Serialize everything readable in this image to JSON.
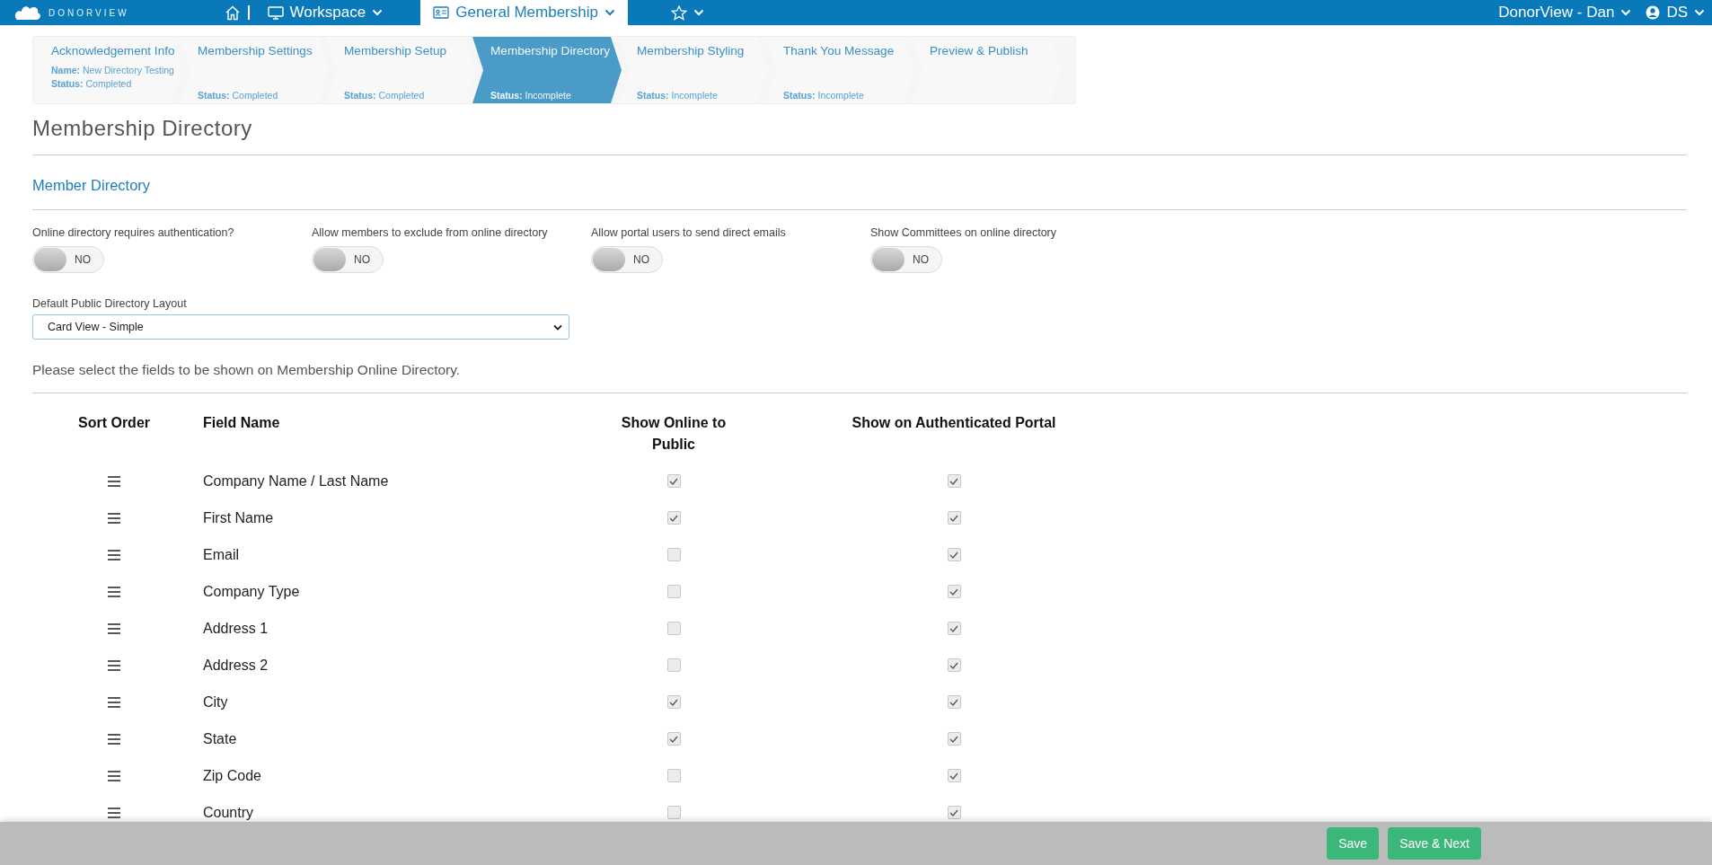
{
  "top_bar": {
    "logo": "DONORVIEW",
    "workspace": "Workspace",
    "module": "General Membership",
    "account": "DonorView - Dan",
    "user": "DS"
  },
  "steps": [
    {
      "title": "Acknowledgement Info",
      "name": "**Name:** New Directory Testing",
      "status": "**Status:** Completed",
      "selected": false
    },
    {
      "title": "Membership Settings",
      "status": "**Status:** Completed",
      "selected": false
    },
    {
      "title": "Membership Setup",
      "status": "**Status:** Completed",
      "selected": false
    },
    {
      "title": "Membership Directory",
      "status": "**Status:** Incomplete",
      "selected": true
    },
    {
      "title": "Membership Styling",
      "status": "**Status:** Incomplete",
      "selected": false
    },
    {
      "title": "Thank You Message",
      "status": "**Status:** Incomplete",
      "selected": false
    },
    {
      "title": "Preview & Publish",
      "selected": false
    }
  ],
  "page_title": "Membership Directory",
  "section_title": "Member Directory",
  "toggles": [
    {
      "label": "Online directory requires authentication?",
      "on": false,
      "state_text": "NO"
    },
    {
      "label": "Allow members to exclude from online directory",
      "on": false,
      "state_text": "NO"
    },
    {
      "label": "Allow portal users to send direct emails",
      "on": false,
      "state_text": "NO"
    },
    {
      "label": "Show Committees on online directory",
      "on": false,
      "state_text": "NO"
    }
  ],
  "layout_select": {
    "label": "Default Public Directory Layout",
    "value": "Card View - Simple"
  },
  "instructions": "Please select the fields to be shown on Membership Online Directory.",
  "table": {
    "columns": [
      "Sort Order",
      "Field Name",
      "Show Online to Public",
      "Show on Authenticated Portal"
    ],
    "rows": [
      {
        "field": "Company Name / Last Name",
        "public": true,
        "portal": true
      },
      {
        "field": "First Name",
        "public": true,
        "portal": true
      },
      {
        "field": "Email",
        "public": false,
        "portal": true
      },
      {
        "field": "Company Type",
        "public": false,
        "portal": true
      },
      {
        "field": "Address 1",
        "public": false,
        "portal": true
      },
      {
        "field": "Address 2",
        "public": false,
        "portal": true
      },
      {
        "field": "City",
        "public": true,
        "portal": true
      },
      {
        "field": "State",
        "public": true,
        "portal": true
      },
      {
        "field": "Zip Code",
        "public": false,
        "portal": true
      },
      {
        "field": "Country",
        "public": false,
        "portal": true
      }
    ]
  },
  "footer_buttons": [
    "Save",
    "Save & Next"
  ]
}
